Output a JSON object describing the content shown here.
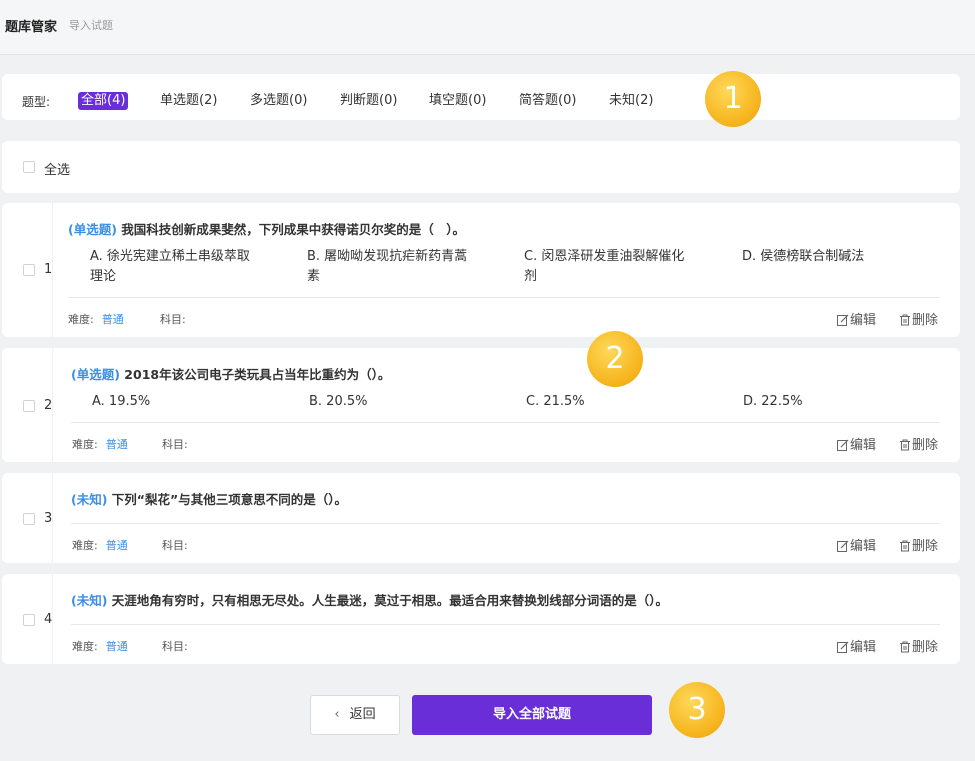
{
  "header": {
    "title": "题库管家",
    "subtitle": "导入试题"
  },
  "filter": {
    "label": "题型:",
    "tabs": [
      {
        "label": "全部(4)",
        "active": true
      },
      {
        "label": "单选题(2)"
      },
      {
        "label": "多选题(0)"
      },
      {
        "label": "判断题(0)"
      },
      {
        "label": "填空题(0)"
      },
      {
        "label": "简答题(0)"
      },
      {
        "label": "未知(2)"
      }
    ]
  },
  "badges": [
    "1",
    "2",
    "3"
  ],
  "select_all": "全选",
  "questions": [
    {
      "num": "1",
      "type": "(单选题)",
      "stem": "我国科技创新成果斐然，下列成果中获得诺贝尔奖的是（　）。",
      "options": [
        [
          "A. 徐光宪建立稀土串级萃取",
          "理论"
        ],
        [
          "B. 屠呦呦发现抗疟新药青蒿",
          "素"
        ],
        [
          "C. 闵恩泽研发重油裂解催化",
          "剂"
        ],
        [
          "D. 侯德榜联合制碱法"
        ]
      ],
      "difficulty_label": "难度:",
      "difficulty": "普通",
      "subject_label": "科目:"
    },
    {
      "num": "2",
      "type": "(单选题)",
      "stem": "2018年该公司电子类玩具占当年比重约为（）。",
      "options": [
        [
          "A. 19.5%"
        ],
        [
          "B. 20.5%"
        ],
        [
          "C. 21.5%"
        ],
        [
          "D. 22.5%"
        ]
      ],
      "difficulty_label": "难度:",
      "difficulty": "普通",
      "subject_label": "科目:"
    },
    {
      "num": "3",
      "type": "(未知)",
      "stem": "下列“梨花”与其他三项意思不同的是（）。",
      "options": [],
      "difficulty_label": "难度:",
      "difficulty": "普通",
      "subject_label": "科目:"
    },
    {
      "num": "4",
      "type": "(未知)",
      "stem": "天涯地角有穷时，只有相思无尽处。人生最迷，莫过于相思。最适合用来替换划线部分词语的是（）。",
      "options": [],
      "difficulty_label": "难度:",
      "difficulty": "普通",
      "subject_label": "科目:"
    }
  ],
  "actions": {
    "edit": "编辑",
    "delete": "删除"
  },
  "footer": {
    "back": "返回",
    "import": "导入全部试题"
  },
  "colors": {
    "accent": "#6a2ed8",
    "link": "#3a8ee6",
    "badge": "#f5b21a"
  }
}
